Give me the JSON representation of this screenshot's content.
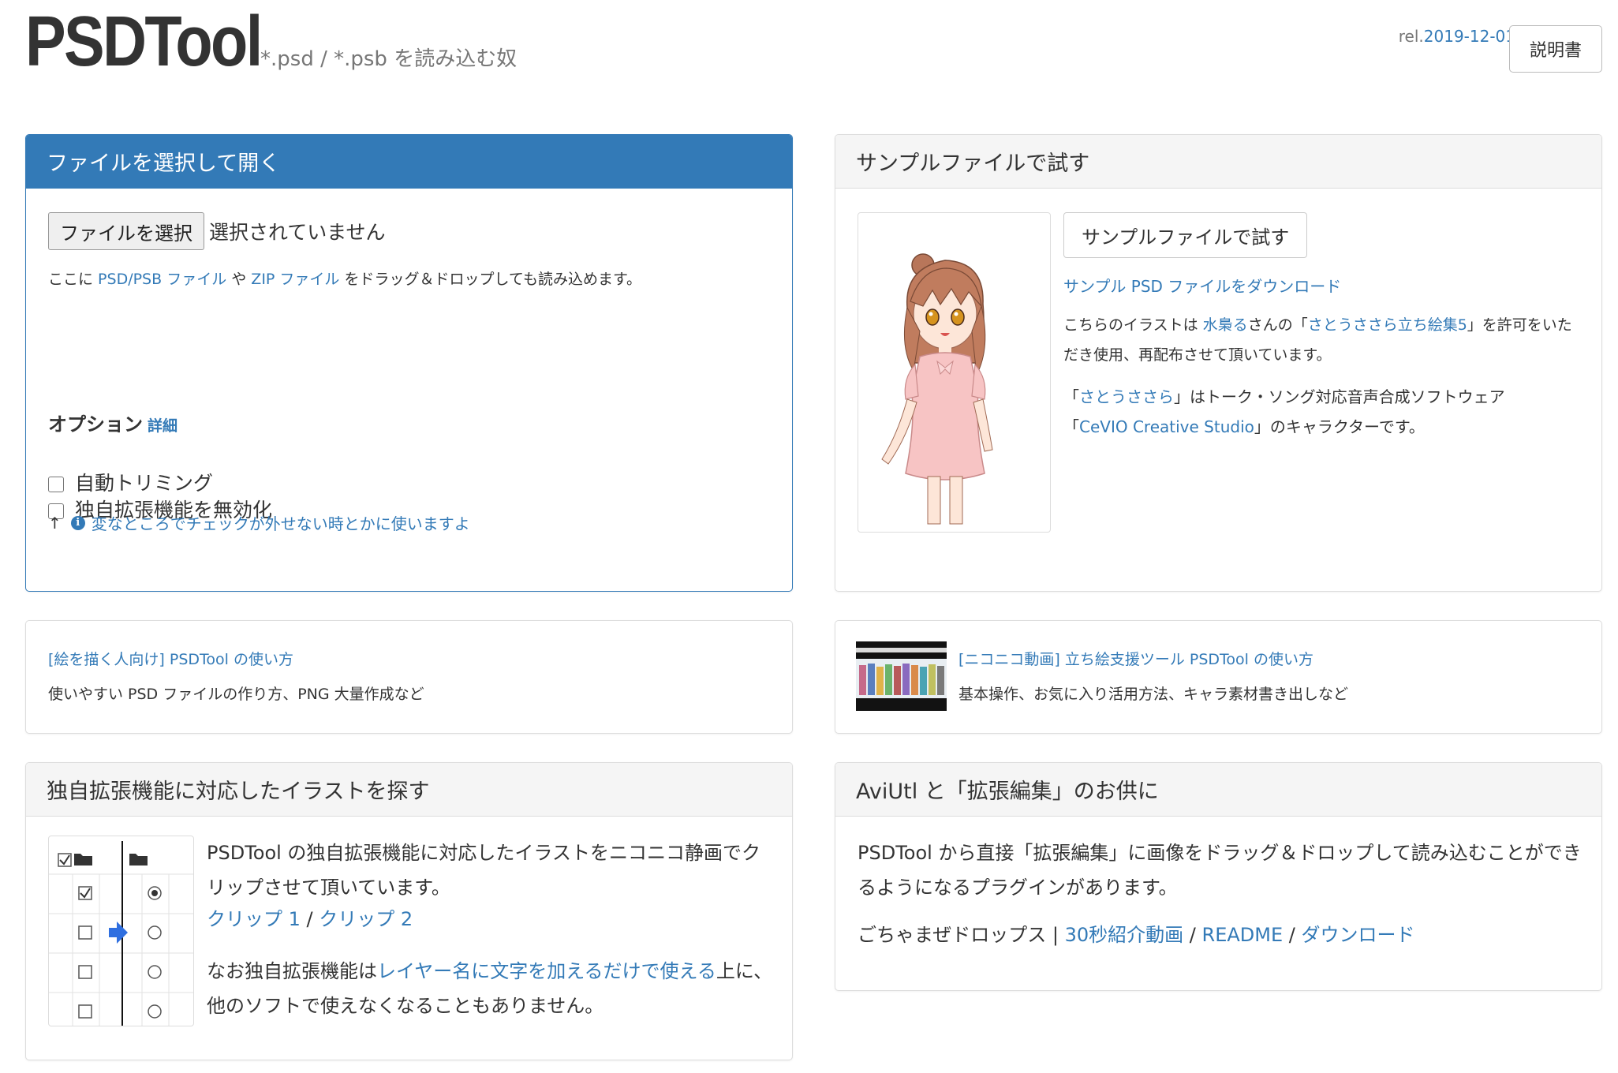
{
  "header": {
    "title": "PSDTool",
    "subtitle": "*.psd / *.psb を読み込む奴",
    "release_prefix": "rel.",
    "release_date": "2019-12-01",
    "manual_button": "説明書"
  },
  "open_panel": {
    "heading": "ファイルを選択して開く",
    "file_button": "ファイルを選択",
    "file_status": "選択されていません",
    "drop_hint": {
      "prefix": "ここに ",
      "link1": "PSD/PSB ファイル",
      "mid": " や ",
      "link2": "ZIP ファイル",
      "suffix": " をドラッグ＆ドロップしても読み込めます。"
    },
    "options": {
      "title": "オプション",
      "detail_link": "詳細",
      "auto_trim": "自動トリミング",
      "disable_ext": "独自拡張機能を無効化",
      "note_arrow": "↑",
      "note_text": "変なところでチェックが外せない時とかに使いますよ"
    }
  },
  "sample_panel": {
    "heading": "サンプルファイルで試す",
    "try_button": "サンプルファイルで試す",
    "download_link": "サンプル PSD ファイルをダウンロード",
    "credit": {
      "t1": "こちらのイラストは ",
      "author": "水梟る",
      "t2": "さんの「",
      "work": "さとうささら立ち絵集5",
      "t3": "」を許可をいただき使用、再配布させて頂いています。"
    },
    "character": {
      "q1": "「",
      "name": "さとうささら",
      "t1": "」はトーク・ソング対応音声合成ソフトウェア",
      "q2": "「",
      "software": "CeVIO Creative Studio",
      "t2": "」のキャラクターです。"
    }
  },
  "guide_panel": {
    "link": "[絵を描く人向け] PSDTool の使い方",
    "desc": "使いやすい PSD ファイルの作り方、PNG 大量作成など"
  },
  "nico_panel": {
    "link": "[ニコニコ動画] 立ち絵支援ツール PSDTool の使い方",
    "desc": "基本操作、お気に入り活用方法、キャラ素材書き出しなど"
  },
  "ext_panel": {
    "heading": "独自拡張機能に対応したイラストを探す",
    "text1": "PSDTool の独自拡張機能に対応したイラストをニコニコ静画でクリップさせて頂いています。",
    "clip1": "クリップ 1",
    "sep": " / ",
    "clip2": "クリップ 2",
    "text2_prefix": "なお独自拡張機能は",
    "text2_link": "レイヤー名に文字を加えるだけで使える",
    "text2_suffix": "上に、他のソフトで使えなくなることもありません。"
  },
  "aviutl_panel": {
    "heading": "AviUtl と「拡張編集」のお供に",
    "text": "PSDTool から直接「拡張編集」に画像をドラッグ＆ドロップして読み込むことができるようになるプラグインがあります。",
    "plugin_name": "ごちゃまぜドロップス",
    "pipe": " | ",
    "link_video": "30秒紹介動画",
    "sep": " / ",
    "link_readme": "README",
    "link_download": "ダウンロード"
  },
  "colors": {
    "primary": "#337ab7",
    "panel_head_bg": "#f5f5f5",
    "text": "#333333",
    "muted": "#777777"
  }
}
